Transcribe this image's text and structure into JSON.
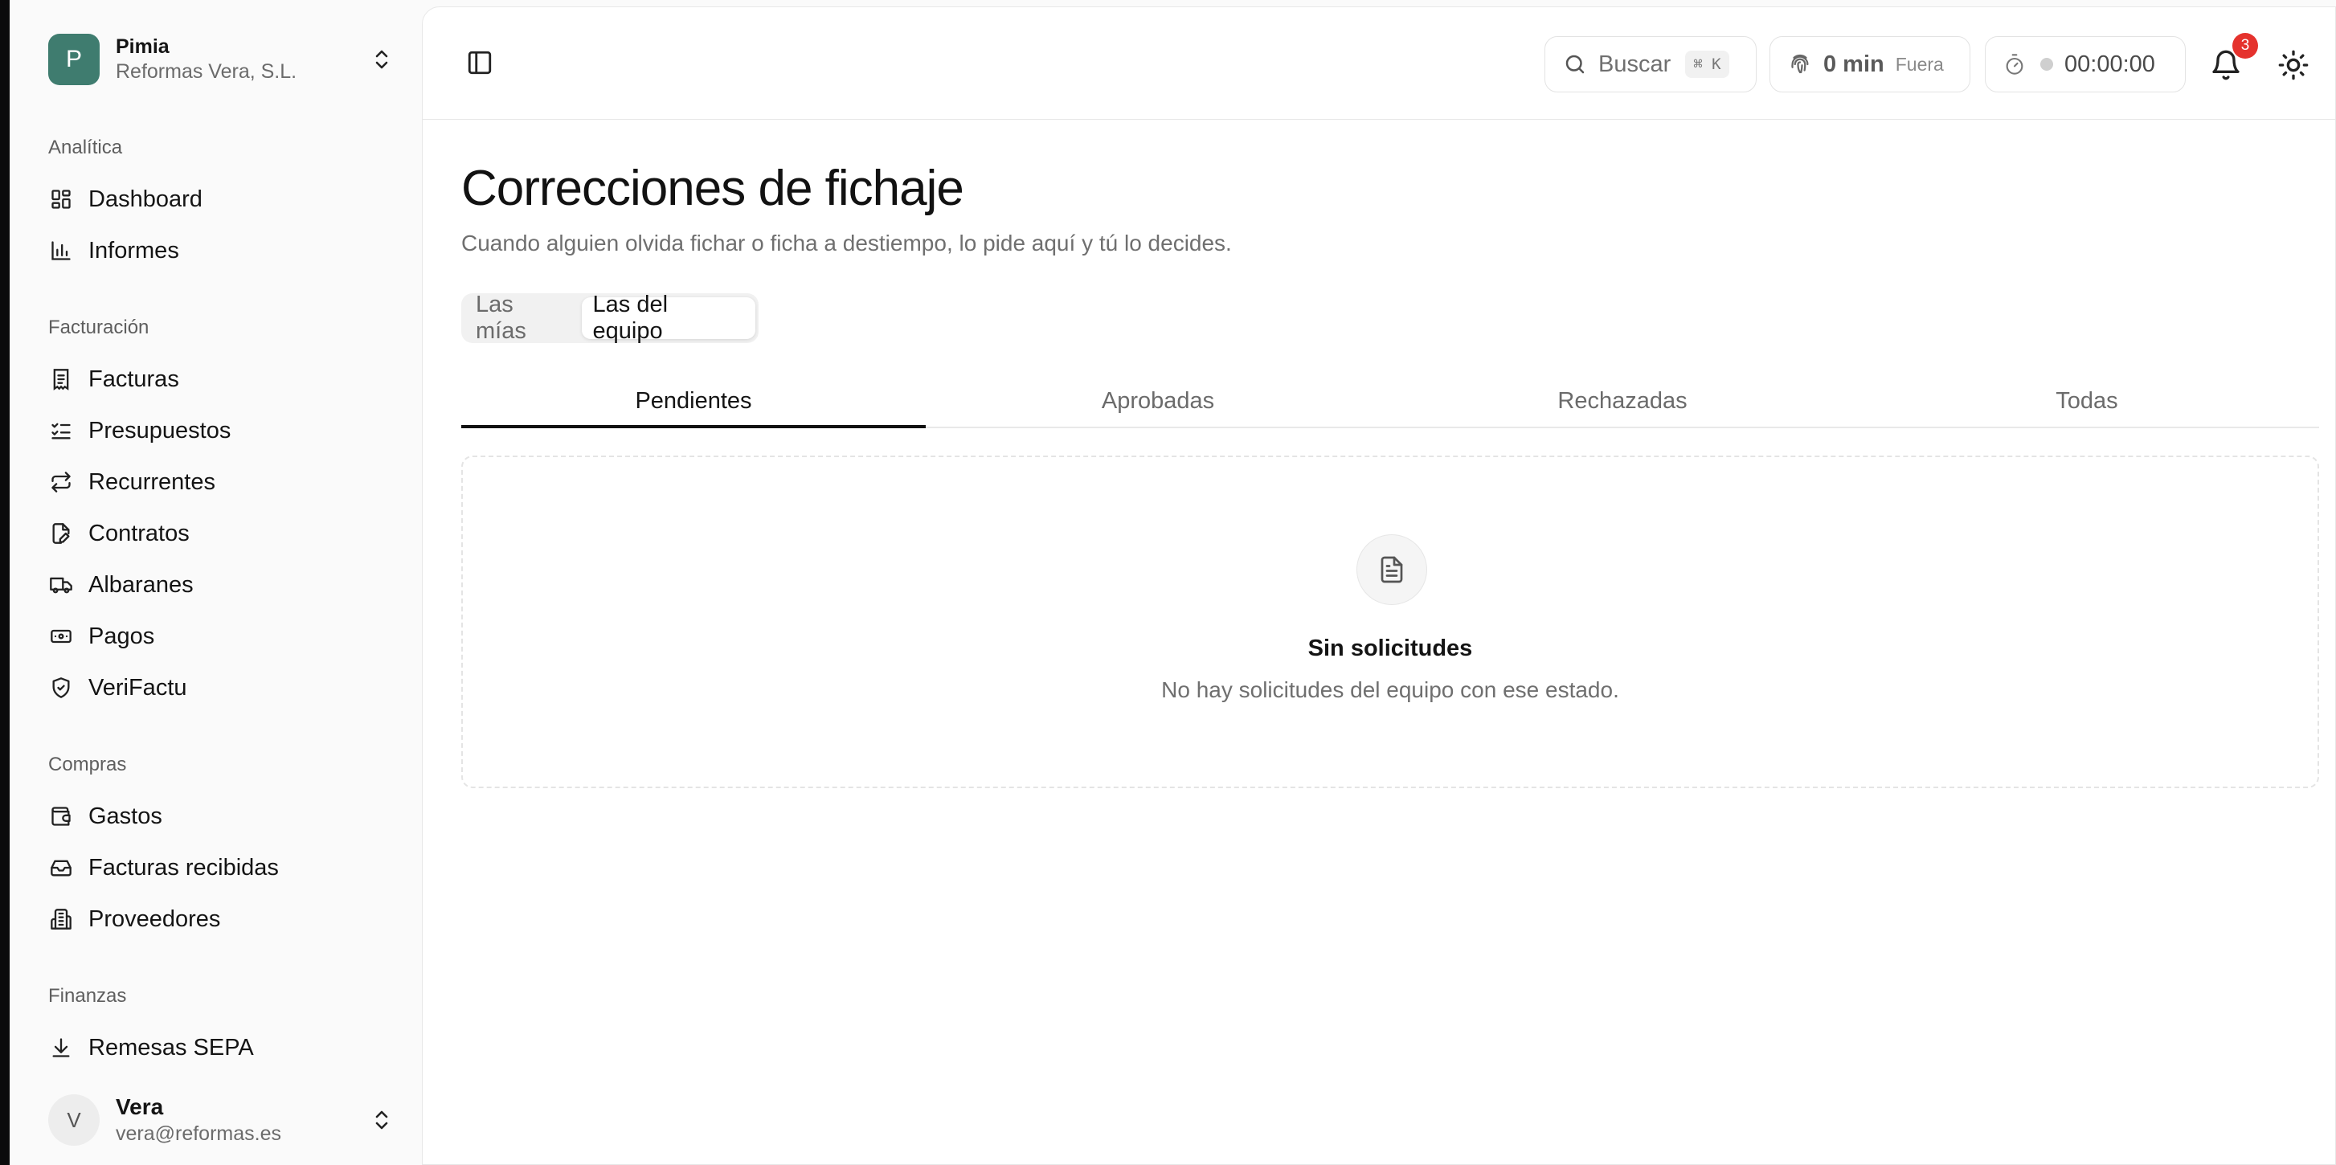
{
  "org": {
    "initial": "P",
    "name": "Pimia",
    "company": "Reformas Vera, S.L."
  },
  "sidebar": {
    "sections": [
      {
        "label": "Analítica",
        "items": [
          {
            "label": "Dashboard",
            "icon": "dashboard-icon"
          },
          {
            "label": "Informes",
            "icon": "bar-chart-icon"
          }
        ]
      },
      {
        "label": "Facturación",
        "items": [
          {
            "label": "Facturas",
            "icon": "receipt-icon"
          },
          {
            "label": "Presupuestos",
            "icon": "list-checks-icon"
          },
          {
            "label": "Recurrentes",
            "icon": "repeat-icon"
          },
          {
            "label": "Contratos",
            "icon": "file-pen-icon"
          },
          {
            "label": "Albaranes",
            "icon": "truck-icon"
          },
          {
            "label": "Pagos",
            "icon": "banknote-icon"
          },
          {
            "label": "VeriFactu",
            "icon": "shield-check-icon"
          }
        ]
      },
      {
        "label": "Compras",
        "items": [
          {
            "label": "Gastos",
            "icon": "wallet-icon"
          },
          {
            "label": "Facturas recibidas",
            "icon": "inbox-icon"
          },
          {
            "label": "Proveedores",
            "icon": "building-icon"
          }
        ]
      },
      {
        "label": "Finanzas",
        "items": [
          {
            "label": "Remesas SEPA",
            "icon": "download-icon"
          }
        ]
      }
    ]
  },
  "user": {
    "initial": "V",
    "name": "Vera",
    "email": "vera@reformas.es"
  },
  "topbar": {
    "search_label": "Buscar",
    "search_shortcut": "⌘ K",
    "clock_minutes": "0 min",
    "clock_state": "Fuera",
    "timer": "00:00:00",
    "notifications_count": "3"
  },
  "page": {
    "title": "Correcciones de fichaje",
    "subtitle": "Cuando alguien olvida fichar o ficha a destiempo, lo pide aquí y tú lo decides."
  },
  "scope_toggle": {
    "options": [
      "Las mías",
      "Las del equipo"
    ],
    "selected": "Las del equipo"
  },
  "tabs": {
    "items": [
      "Pendientes",
      "Aprobadas",
      "Rechazadas",
      "Todas"
    ],
    "selected": "Pendientes"
  },
  "empty_state": {
    "title": "Sin solicitudes",
    "description": "No hay solicitudes del equipo con ese estado."
  },
  "colors": {
    "org_avatar": "#3f7c6f",
    "badge": "#e5322d"
  }
}
